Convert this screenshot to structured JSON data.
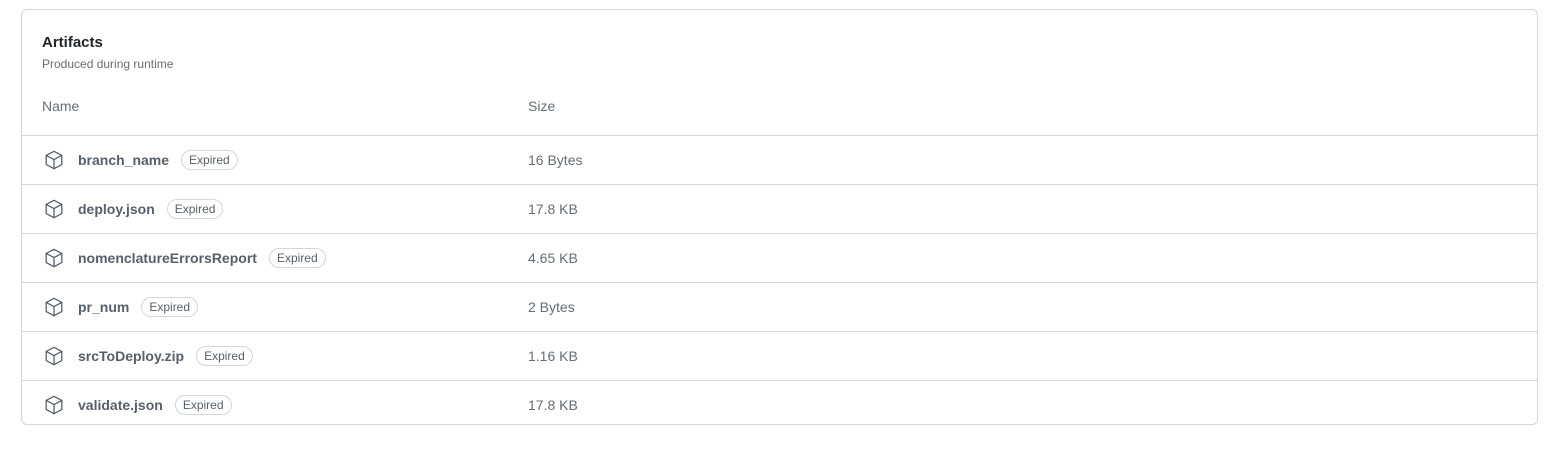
{
  "artifacts": {
    "title": "Artifacts",
    "subtitle": "Produced during runtime",
    "columns": {
      "name": "Name",
      "size": "Size"
    },
    "icon": "package-icon",
    "items": [
      {
        "name": "branch_name",
        "status": "Expired",
        "size": "16 Bytes"
      },
      {
        "name": "deploy.json",
        "status": "Expired",
        "size": "17.8 KB"
      },
      {
        "name": "nomenclatureErrorsReport",
        "status": "Expired",
        "size": "4.65 KB"
      },
      {
        "name": "pr_num",
        "status": "Expired",
        "size": "2 Bytes"
      },
      {
        "name": "srcToDeploy.zip",
        "status": "Expired",
        "size": "1.16 KB"
      },
      {
        "name": "validate.json",
        "status": "Expired",
        "size": "17.8 KB"
      }
    ]
  }
}
